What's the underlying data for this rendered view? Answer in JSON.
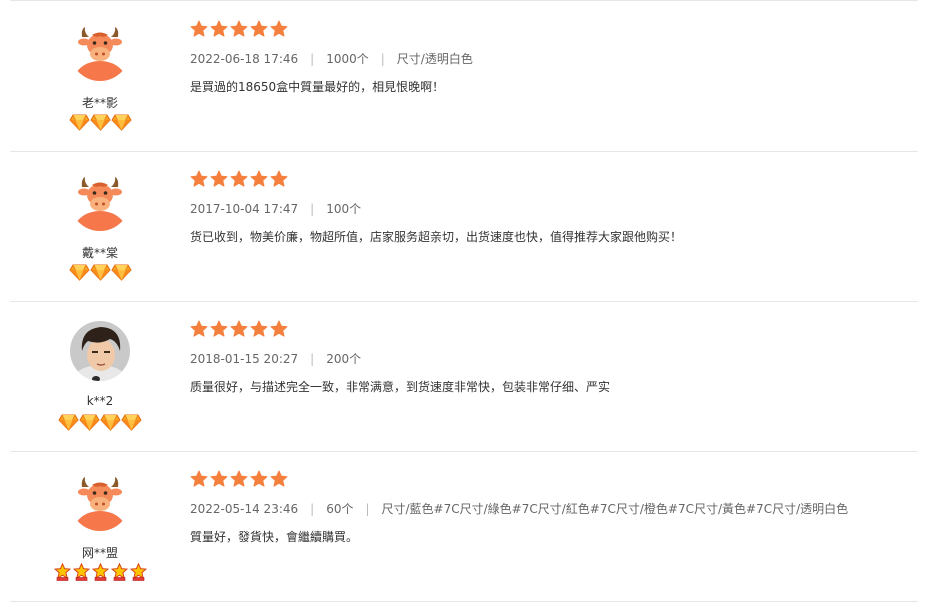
{
  "colors": {
    "star": "#f5803e",
    "avatar_bg": "#f37b4e",
    "divider": "#e6e6e6",
    "gem": "#f7931e",
    "crown": "#f5b400"
  },
  "reviews": [
    {
      "user": "老**影",
      "avatar_icon": "cow-avatar-icon",
      "level_icons": [
        "diamond-icon",
        "diamond-icon",
        "diamond-icon"
      ],
      "rating": 5,
      "date": "2022-06-18 17:46",
      "quantity": "1000个",
      "spec": "尺寸/透明白色",
      "text": "是買過的18650盒中質量最好的，相見恨晚啊！"
    },
    {
      "user": "戴**棠",
      "avatar_icon": "cow-avatar-icon",
      "level_icons": [
        "diamond-icon",
        "diamond-icon",
        "diamond-icon"
      ],
      "rating": 5,
      "date": "2017-10-04 17:47",
      "quantity": "100个",
      "spec": "",
      "text": "货已收到，物美价廉，物超所值，店家服务超亲切，出货速度也快，值得推荐大家跟他购买！"
    },
    {
      "user": "k**2",
      "avatar_icon": "user-photo-avatar",
      "level_icons": [
        "diamond-icon",
        "diamond-icon",
        "diamond-icon",
        "diamond-icon"
      ],
      "rating": 5,
      "date": "2018-01-15 20:27",
      "quantity": "200个",
      "spec": "",
      "text": "质量很好，与描述完全一致，非常满意，到货速度非常快，包装非常仔细、严实"
    },
    {
      "user": "网**盟",
      "avatar_icon": "cow-avatar-icon",
      "level_icons": [
        "crown-icon",
        "crown-icon",
        "crown-icon",
        "crown-icon",
        "crown-icon"
      ],
      "rating": 5,
      "date": "2022-05-14 23:46",
      "quantity": "60个",
      "spec": "尺寸/藍色#7C尺寸/綠色#7C尺寸/紅色#7C尺寸/橙色#7C尺寸/黃色#7C尺寸/透明白色",
      "text": "質量好，發貨快，會繼續購買。"
    }
  ]
}
